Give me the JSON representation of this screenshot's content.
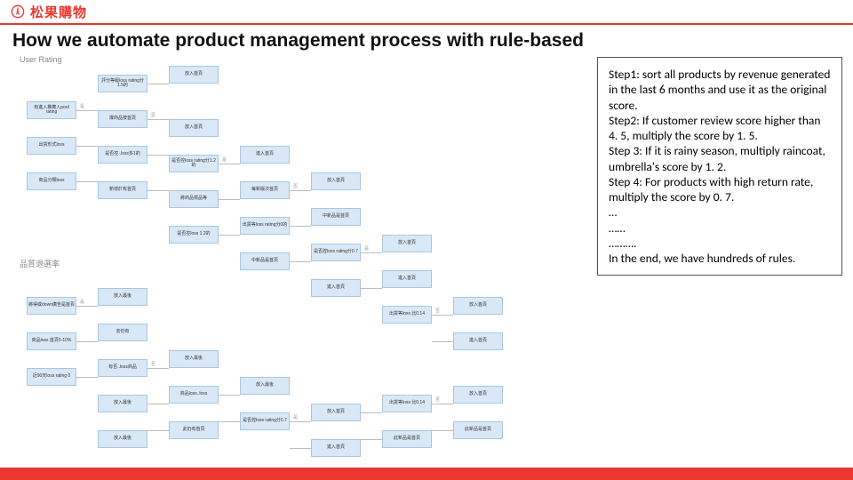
{
  "header": {
    "logo_text": "松果購物"
  },
  "title": "How we automate product management process with rule-based",
  "labels": {
    "section_top": "User Rating",
    "section_bottom": "品質退選率"
  },
  "nodes": {
    "n1": "有進入推薦入pool rating",
    "n2": "評分等級loss rating分1.5的",
    "n3": "出貨形式loss",
    "n4": "商品分類loss",
    "n5": "放入首頁",
    "n6": "爆商品按首頁",
    "n7": "將商品標品等",
    "n8": "是否控..loss多1的",
    "n9": "放入首頁",
    "n10": "進入首頁",
    "n11": "新增於有首頁",
    "n12": "是否控loss rating分1.2的",
    "n13": "每新版次首頁",
    "n14": "放入首頁",
    "n15": "中新品是首頁",
    "n16": "出貨等loss rating分0的",
    "n17": "是否控loss 1.2的",
    "n18": "中新品是首頁",
    "n19": "放入首頁",
    "n20": "進入首頁",
    "n21": "是否控loss rating分0.7",
    "n22": "放入首頁",
    "n23": "進入首頁",
    "n24": "出貨等loss 比0.14",
    "n30": "將得或down廣告是首頁",
    "n31": "商品loss 首頁5-10%",
    "n32": "近90天loss rating 0",
    "n33": "放入最後",
    "n34": "去仍有",
    "n35": "放入最後",
    "n36": "有否..loss商品",
    "n37": "放入最後",
    "n38": "放入最後",
    "n39": "商品loss..loss",
    "n40": "此仍有首頁",
    "n41": "是否控loss rating分0.7",
    "n42": "放入首頁",
    "n43": "進入首頁",
    "n44": "出貨等loss 比0.14",
    "n45": "放入首頁",
    "n46": "此新品是首頁"
  },
  "edge_labels": {
    "yes": "是",
    "no": "否"
  },
  "rules": {
    "l1": "Step1: sort all products by revenue generated in the last 6 months and use it as the original score.",
    "l2": "Step2: If customer review score higher than 4. 5, multiply the score by 1. 5.",
    "l3": "Step 3: If it is rainy season, multiply raincoat, umbrella's score by 1. 2.",
    "l4": "Step 4: For products with high return rate, multiply the score by 0. 7.",
    "l5": "…",
    "l6": "……",
    "l7": "……….",
    "l8": "In the end, we have hundreds of rules."
  }
}
